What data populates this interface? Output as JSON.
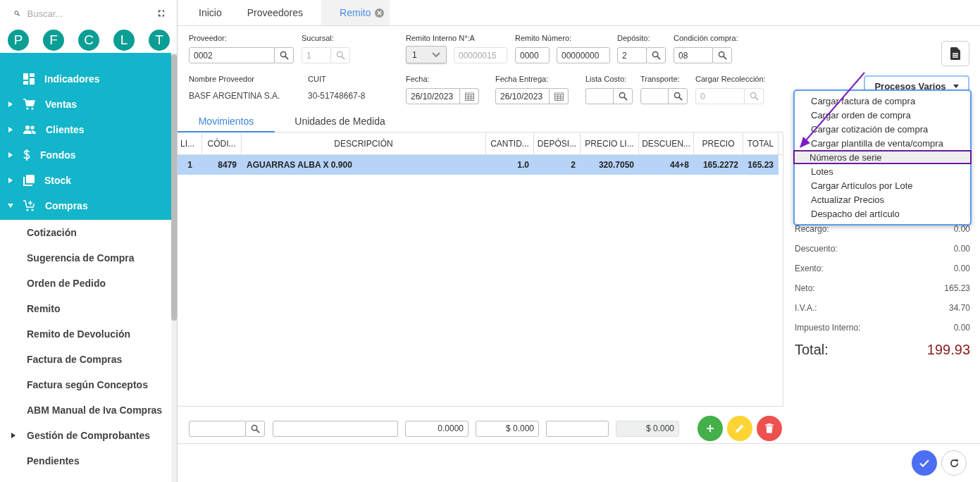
{
  "sidebar": {
    "search": {
      "placeholder": "Buscar..."
    },
    "shortcuts": [
      "P",
      "F",
      "C",
      "L",
      "T"
    ],
    "menu": [
      {
        "label": "Indicadores"
      },
      {
        "label": "Ventas",
        "expanded": false
      },
      {
        "label": "Clientes",
        "expanded": false
      },
      {
        "label": "Fondos",
        "expanded": false
      },
      {
        "label": "Stock",
        "expanded": false
      },
      {
        "label": "Compras",
        "expanded": true,
        "children": [
          {
            "label": "Cotización"
          },
          {
            "label": "Sugerencia de Compra"
          },
          {
            "label": "Orden de Pedido"
          },
          {
            "label": "Remito"
          },
          {
            "label": "Remito de Devolución"
          },
          {
            "label": "Factura de Compras"
          },
          {
            "label": "Factura según Conceptos"
          },
          {
            "label": "ABM Manual de Iva Compras"
          },
          {
            "label": "Gestión de Comprobantes",
            "expanded": false
          },
          {
            "label": "Pendientes"
          }
        ]
      }
    ]
  },
  "tabs": [
    {
      "label": "Inicio",
      "selected": false
    },
    {
      "label": "Proveedores",
      "selected": false
    },
    {
      "label": "Remito",
      "selected": true,
      "closable": true
    }
  ],
  "form": {
    "rows": [
      [
        {
          "kind": "lookup",
          "label": "Proveedor:",
          "value": "0002",
          "disabled": false
        },
        {
          "kind": "lookup",
          "label": "Sucursal:",
          "value": "1",
          "disabled": true
        },
        {
          "kind": "select-number",
          "label": "Remito Interno N°:A",
          "value": "1",
          "number": "00000015"
        },
        {
          "kind": "pair",
          "label": "Remito Número:",
          "values": [
            "0000",
            "00000000"
          ]
        },
        {
          "kind": "lookup",
          "label": "Depósito:",
          "value": "2",
          "disabled": false
        },
        {
          "kind": "lookup",
          "label": "Condición compra:",
          "value": "08",
          "disabled": false
        }
      ],
      [
        {
          "kind": "display",
          "label": "Nombre Proveedor",
          "value": "BASF ARGENTINA S.A."
        },
        {
          "kind": "display",
          "label": "CUIT",
          "value": "30-51748667-8"
        },
        {
          "kind": "date",
          "label": "Fecha:",
          "value": "26/10/2023"
        },
        {
          "kind": "date",
          "label": "Fecha Entrega:",
          "value": "26/10/2023"
        },
        {
          "kind": "lookup",
          "label": "Lista Costo:",
          "disabled": false
        },
        {
          "kind": "lookup",
          "label": "Transporte:",
          "disabled": false
        },
        {
          "kind": "lookup",
          "label": "Cargar Recolección:",
          "value": "0",
          "disabled": true
        }
      ]
    ]
  },
  "subtabs": [
    {
      "label": "Movimientos",
      "selected": true
    },
    {
      "label": "Unidades de Medida",
      "selected": false
    }
  ],
  "table": {
    "columns": [
      "LI...",
      "CÓDI...",
      "DESCRIPCIÓN",
      "CANTID...",
      "DEPÓSI...",
      "PRECIO LI...",
      "DESCUEN...",
      "PRECIO",
      "TOTAL"
    ],
    "rows": [
      {
        "selected": true,
        "cells": [
          "1",
          "8479",
          "AGUARRAS ALBA X 0.900",
          "1.0",
          "2",
          "320.7050",
          "44+8",
          "165.2272",
          "165.23"
        ]
      }
    ]
  },
  "entry_row": [
    {
      "kind": "lookup"
    },
    {
      "kind": "text"
    },
    {
      "kind": "text",
      "value": "0.0000"
    },
    {
      "kind": "text",
      "value": "$ 0.000"
    },
    {
      "kind": "text"
    },
    {
      "kind": "readonly",
      "value": "$ 0.000"
    }
  ],
  "processes": {
    "label": "Procesos Varios",
    "menu": [
      {
        "label": "Cargar factura de compra",
        "selected": false
      },
      {
        "label": "Cargar orden de compra",
        "selected": false
      },
      {
        "label": "Cargar cotización de compra",
        "selected": false
      },
      {
        "label": "Cargar plantilla de venta/compra",
        "selected": false
      },
      {
        "label": "Números de serie",
        "selected": true
      },
      {
        "label": "Lotes",
        "selected": false
      },
      {
        "label": "Cargar Artículos por Lote",
        "selected": false
      },
      {
        "label": "Actualizar Precios",
        "selected": false
      },
      {
        "label": "Despacho del artículo",
        "selected": false
      }
    ]
  },
  "summary": [
    {
      "label": "Recargo:",
      "value": "0.00"
    },
    {
      "label": "Descuento:",
      "value": "0.00"
    },
    {
      "label": "Exento:",
      "value": "0.00"
    },
    {
      "label": "Neto:",
      "value": "165.23"
    },
    {
      "label": "I.V.A.:",
      "value": "34.70"
    },
    {
      "label": "Impuesto Interno:",
      "value": "0.00"
    }
  ],
  "total": {
    "label": "Total:",
    "value": "199.93"
  }
}
